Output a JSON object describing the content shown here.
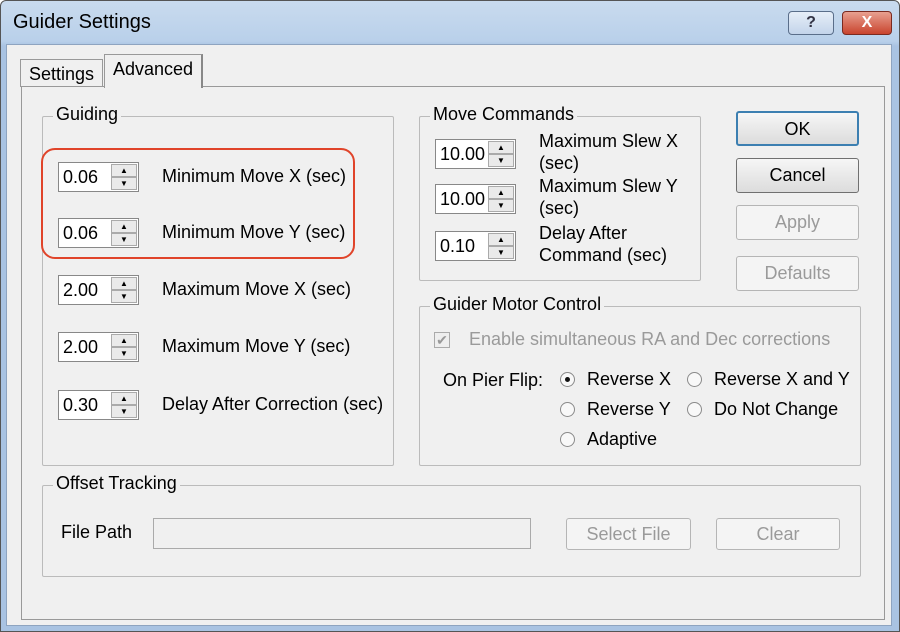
{
  "window": {
    "title": "Guider Settings",
    "help_label": "?",
    "close_label": "X"
  },
  "tabs": [
    {
      "label": "Settings",
      "active": false
    },
    {
      "label": "Advanced",
      "active": true
    }
  ],
  "guiding": {
    "title": "Guiding",
    "rows": [
      {
        "value": "0.06",
        "label": "Minimum Move X (sec)",
        "highlighted": true
      },
      {
        "value": "0.06",
        "label": "Minimum Move Y (sec)",
        "highlighted": true
      },
      {
        "value": "2.00",
        "label": "Maximum Move X (sec)"
      },
      {
        "value": "2.00",
        "label": "Maximum Move Y (sec)"
      },
      {
        "value": "0.30",
        "label": "Delay After Correction (sec)"
      }
    ],
    "highlight_color": "#e0442a"
  },
  "move_commands": {
    "title": "Move Commands",
    "rows": [
      {
        "value": "10.00",
        "label1": "Maximum Slew X",
        "label2": "(sec)"
      },
      {
        "value": "10.00",
        "label1": "Maximum Slew Y",
        "label2": "(sec)"
      },
      {
        "value": "0.10",
        "label1": "Delay After",
        "label2": "Command (sec)"
      }
    ]
  },
  "buttons": {
    "ok": "OK",
    "cancel": "Cancel",
    "apply": "Apply",
    "defaults": "Defaults"
  },
  "motor": {
    "title": "Guider Motor Control",
    "simultaneous_label": "Enable simultaneous RA and Dec corrections",
    "simultaneous_checked": true,
    "simultaneous_enabled": false,
    "pier_flip_label": "On Pier Flip:",
    "options": [
      {
        "label": "Reverse X",
        "selected": true
      },
      {
        "label": "Reverse X and Y",
        "selected": false
      },
      {
        "label": "Reverse Y",
        "selected": false
      },
      {
        "label": "Do Not Change",
        "selected": false
      },
      {
        "label": "Adaptive",
        "selected": false
      }
    ]
  },
  "offset": {
    "title": "Offset Tracking",
    "file_path_label": "File Path",
    "file_path_value": "",
    "select_file": "Select File",
    "clear": "Clear"
  }
}
